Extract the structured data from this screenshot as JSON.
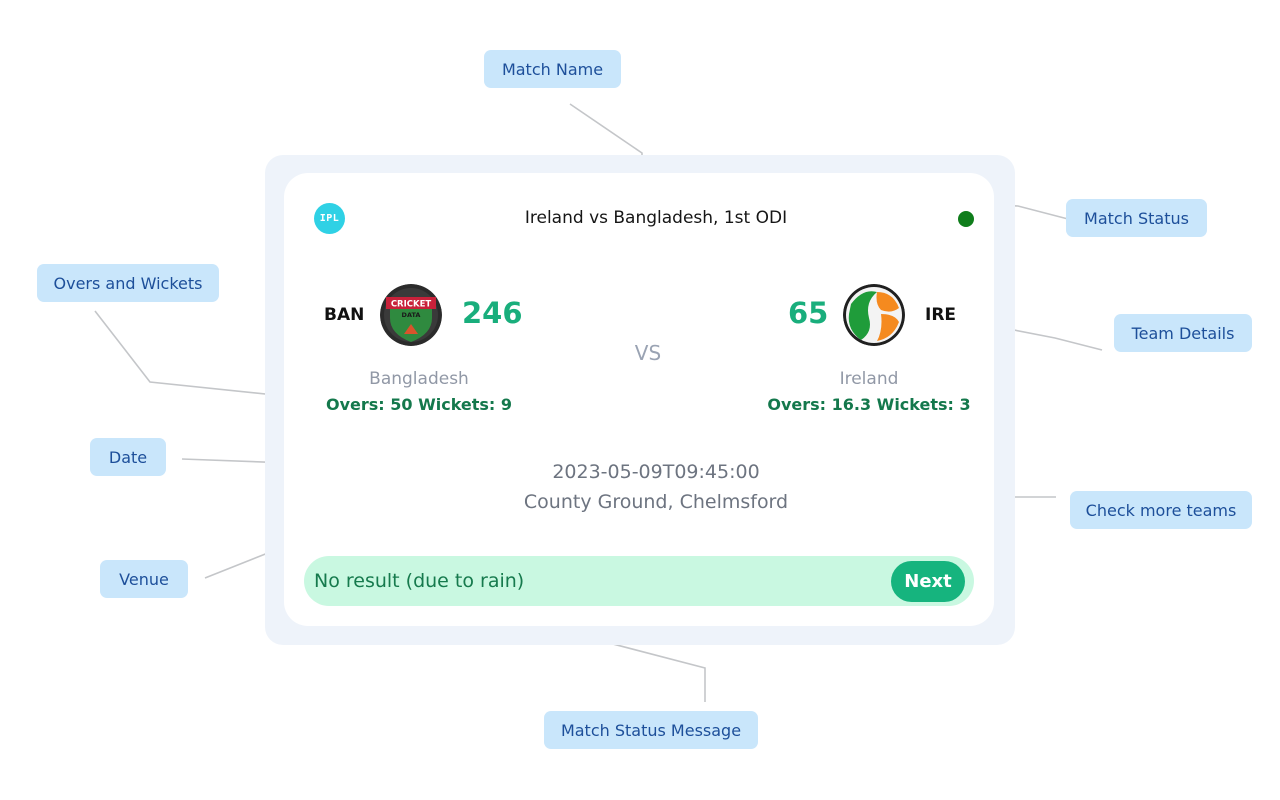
{
  "annotations": {
    "match_name": "Match Name",
    "match_status": "Match Status",
    "overs_and_wickets": "Overs and Wickets",
    "team_details": "Team Details",
    "date": "Date",
    "check_more_teams": "Check more teams",
    "venue": "Venue",
    "match_status_message": "Match Status Message"
  },
  "card": {
    "series_logo": "IPL",
    "match_name": "Ireland vs Bangladesh, 1st ODI",
    "status_color": "#0f7d1b",
    "vs_label": "VS",
    "team_left": {
      "code": "BAN",
      "name": "Bangladesh",
      "score": "246",
      "stats": "Overs: 50 Wickets: 9",
      "logo_text_top": "CRICKET",
      "logo_text_bottom": "DATA",
      "logo_icon": "cricket-data-logo-icon"
    },
    "team_right": {
      "code": "IRE",
      "name": "Ireland",
      "score": "65",
      "stats": "Overs: 16.3 Wickets: 3",
      "logo_icon": "ireland-flag-icon"
    },
    "date": "2023-05-09T09:45:00",
    "venue": "County Ground, Chelmsford",
    "status_message": "No result (due to rain)",
    "next_label": "Next"
  },
  "colors": {
    "score": "#19ae7c",
    "stats": "#14784c",
    "result_bar": "#c9f8e1",
    "next_button": "#16b47e",
    "callout_bg": "#c9e6fb",
    "callout_text": "#1d4f9a"
  }
}
